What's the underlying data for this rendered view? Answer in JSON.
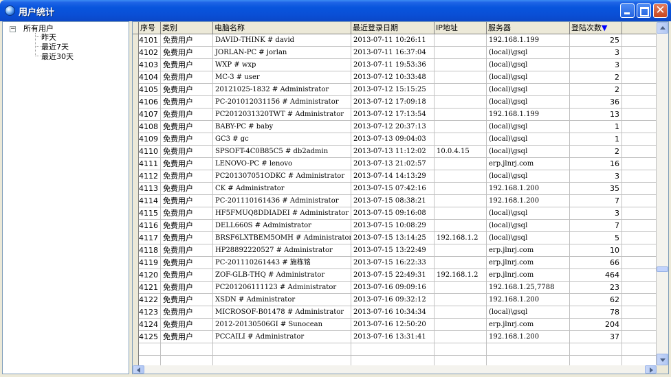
{
  "window": {
    "title": "用户统计"
  },
  "tree": {
    "root": "所有用户",
    "expander": "−",
    "children": [
      "昨天",
      "最近7天",
      "最近30天"
    ]
  },
  "grid": {
    "columns": [
      "序号",
      "类别",
      "电脑名称",
      "最近登录日期",
      "IP地址",
      "服务器",
      "登陆次数"
    ],
    "sort_indicator": "▼",
    "rows": [
      [
        "4101",
        "免费用户",
        "DAVID-THINK # david",
        "2013-07-11 10:26:11",
        "",
        "192.168.1.199",
        "25"
      ],
      [
        "4102",
        "免费用户",
        "JORLAN-PC # jorlan",
        "2013-07-11 16:37:04",
        "",
        "(local)\\gsql",
        "3"
      ],
      [
        "4103",
        "免费用户",
        "WXP # wxp",
        "2013-07-11 19:53:36",
        "",
        "(local)\\gsql",
        "3"
      ],
      [
        "4104",
        "免费用户",
        "MC-3 # user",
        "2013-07-12 10:33:48",
        "",
        "(local)\\gsql",
        "2"
      ],
      [
        "4105",
        "免费用户",
        "20121025-1832 # Administrator",
        "2013-07-12 15:15:25",
        "",
        "(local)\\gsql",
        "2"
      ],
      [
        "4106",
        "免费用户",
        "PC-201012031156 # Administrator",
        "2013-07-12 17:09:18",
        "",
        "(local)\\gsql",
        "36"
      ],
      [
        "4107",
        "免费用户",
        "PC2012031320TWT # Administrator",
        "2013-07-12 17:13:54",
        "",
        "192.168.1.199",
        "13"
      ],
      [
        "4108",
        "免费用户",
        "BABY-PC # baby",
        "2013-07-12 20:37:13",
        "",
        "(local)\\gsql",
        "1"
      ],
      [
        "4109",
        "免费用户",
        "GC3 # gc",
        "2013-07-13 09:04:03",
        "",
        "(local)\\gsql",
        "1"
      ],
      [
        "4110",
        "免费用户",
        "SPSOFT-4C0B85C5 # db2admin",
        "2013-07-13 11:12:02",
        "10.0.4.15",
        "(local)\\gsql",
        "2"
      ],
      [
        "4111",
        "免费用户",
        "LENOVO-PC # lenovo",
        "2013-07-13 21:02:57",
        "",
        "erp.jlnrj.com",
        "16"
      ],
      [
        "4112",
        "免费用户",
        "PC201307051ODKC # Administrator",
        "2013-07-14 14:13:29",
        "",
        "(local)\\gsql",
        "3"
      ],
      [
        "4113",
        "免费用户",
        "CK # Administrator",
        "2013-07-15 07:42:16",
        "",
        "192.168.1.200",
        "35"
      ],
      [
        "4114",
        "免费用户",
        "PC-201110161436 # Administrator",
        "2013-07-15 08:38:21",
        "",
        "192.168.1.200",
        "7"
      ],
      [
        "4115",
        "免费用户",
        "HF5FMUQ8DDIADEI # Administrator",
        "2013-07-15 09:16:08",
        "",
        "(local)\\gsql",
        "3"
      ],
      [
        "4116",
        "免费用户",
        "DELL660S # Administrator",
        "2013-07-15 10:08:29",
        "",
        "(local)\\gsql",
        "7"
      ],
      [
        "4117",
        "免费用户",
        "BRSF6LXTBEM5OMH # Administrator",
        "2013-07-15 13:14:25",
        "192.168.1.2",
        "(local)\\gsql",
        "5"
      ],
      [
        "4118",
        "免费用户",
        "HP28892220527 # Administrator",
        "2013-07-15 13:22:49",
        "",
        "erp.jlnrj.com",
        "10"
      ],
      [
        "4119",
        "免费用户",
        "PC-201110261443 # 施栋铭",
        "2013-07-15 16:22:33",
        "",
        "erp.jlnrj.com",
        "66"
      ],
      [
        "4120",
        "免费用户",
        "ZOF-GLB-THQ # Administrator",
        "2013-07-15 22:49:31",
        "192.168.1.2",
        "erp.jlnrj.com",
        "464"
      ],
      [
        "4121",
        "免费用户",
        "PC201206111123 # Administrator",
        "2013-07-16 09:09:16",
        "",
        "192.168.1.25,7788",
        "23"
      ],
      [
        "4122",
        "免费用户",
        "XSDN # Administrator",
        "2013-07-16 09:32:12",
        "",
        "192.168.1.200",
        "62"
      ],
      [
        "4123",
        "免费用户",
        "MICROSOF-B01478 # Administrator",
        "2013-07-16 10:34:34",
        "",
        "(local)\\gsql",
        "78"
      ],
      [
        "4124",
        "免费用户",
        "2012-20130506GI # Sunocean",
        "2013-07-16 12:50:20",
        "",
        "erp.jlnrj.com",
        "204"
      ],
      [
        "4125",
        "免费用户",
        "PCCAILI # Administrator",
        "2013-07-16 13:31:41",
        "",
        "192.168.1.200",
        "37"
      ]
    ]
  }
}
